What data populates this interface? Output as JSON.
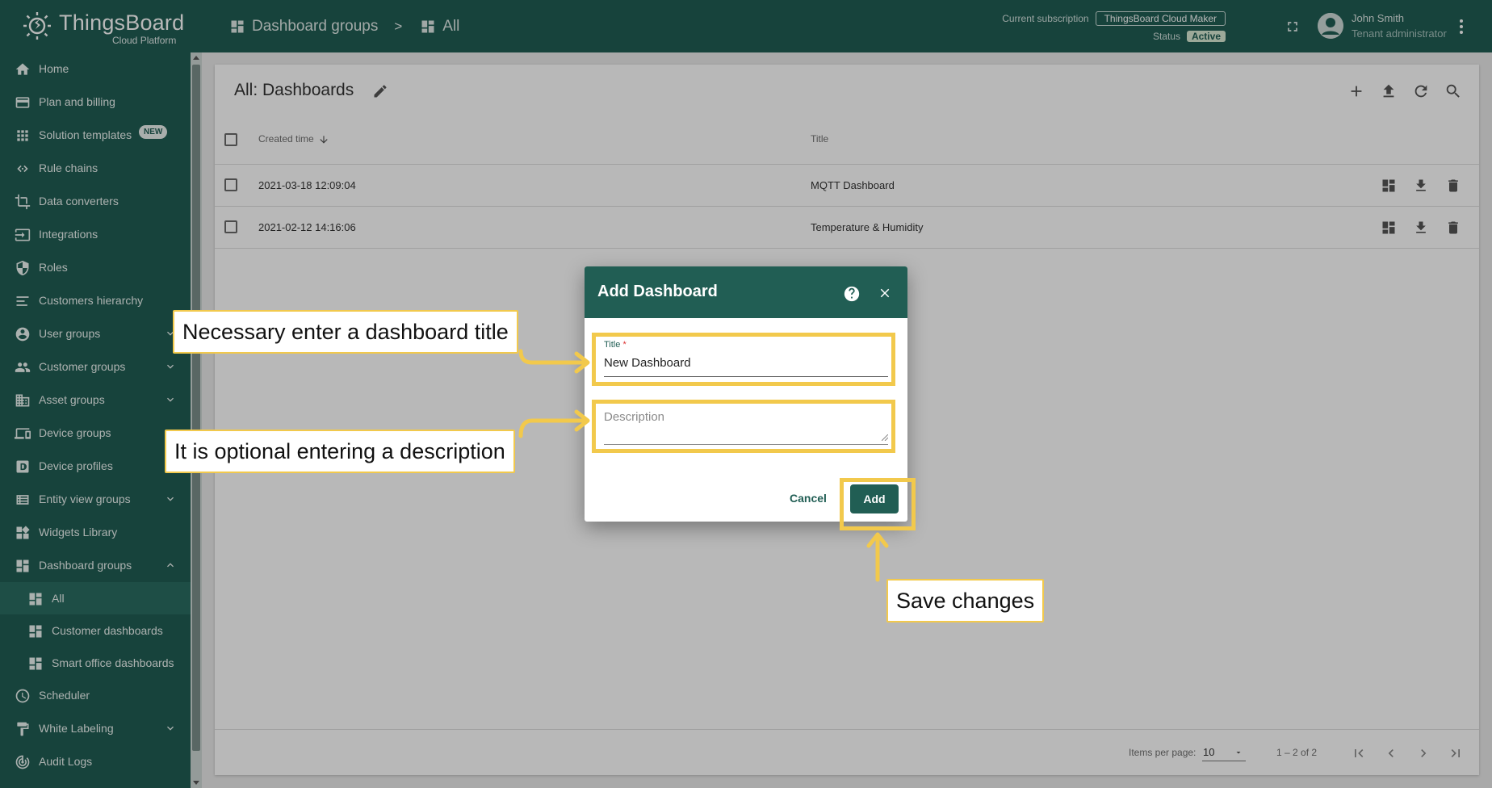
{
  "app": {
    "name": "ThingsBoard",
    "subtitle": "Cloud Platform"
  },
  "breadcrumb": {
    "first": "Dashboard groups",
    "separator": ">",
    "second": "All"
  },
  "subscription": {
    "label": "Current subscription",
    "plan": "ThingsBoard Cloud Maker",
    "status_label": "Status",
    "status": "Active"
  },
  "user": {
    "name": "John Smith",
    "role": "Tenant administrator"
  },
  "sidebar": {
    "items": [
      {
        "label": "Home",
        "icon": "home-icon"
      },
      {
        "label": "Plan and billing",
        "icon": "credit-card-icon"
      },
      {
        "label": "Solution templates",
        "icon": "apps-grid-icon",
        "badge": "NEW"
      },
      {
        "label": "Rule chains",
        "icon": "rule-chain-icon"
      },
      {
        "label": "Data converters",
        "icon": "converter-icon"
      },
      {
        "label": "Integrations",
        "icon": "integration-icon"
      },
      {
        "label": "Roles",
        "icon": "shield-icon"
      },
      {
        "label": "Customers hierarchy",
        "icon": "hierarchy-icon"
      },
      {
        "label": "User groups",
        "icon": "account-circle-icon"
      },
      {
        "label": "Customer groups",
        "icon": "people-icon"
      },
      {
        "label": "Asset groups",
        "icon": "domain-icon"
      },
      {
        "label": "Device groups",
        "icon": "devices-icon"
      },
      {
        "label": "Device profiles",
        "icon": "device-profile-icon"
      },
      {
        "label": "Entity view groups",
        "icon": "view-list-icon"
      },
      {
        "label": "Widgets Library",
        "icon": "widgets-icon"
      },
      {
        "label": "Dashboard groups",
        "icon": "dashboard-icon"
      },
      {
        "label": "All",
        "icon": "dashboard-icon"
      },
      {
        "label": "Customer dashboards",
        "icon": "dashboard-icon"
      },
      {
        "label": "Smart office dashboards",
        "icon": "dashboard-icon"
      },
      {
        "label": "Scheduler",
        "icon": "clock-icon"
      },
      {
        "label": "White Labeling",
        "icon": "format-paint-icon"
      },
      {
        "label": "Audit Logs",
        "icon": "track-changes-icon"
      }
    ]
  },
  "main": {
    "title": "All: Dashboards",
    "columns": {
      "created": "Created time",
      "title": "Title"
    },
    "rows": [
      {
        "created": "2021-03-18 12:09:04",
        "title": "MQTT Dashboard"
      },
      {
        "created": "2021-02-12 14:16:06",
        "title": "Temperature & Humidity"
      }
    ],
    "paginator": {
      "items_label": "Items per page:",
      "page_size": "10",
      "range": "1 – 2 of 2"
    }
  },
  "dialog": {
    "title": "Add Dashboard",
    "title_field_label": "Title",
    "title_field_required": "*",
    "title_field_value": "New Dashboard",
    "description_placeholder": "Description",
    "cancel_label": "Cancel",
    "add_label": "Add"
  },
  "annotations": {
    "title_note": "Necessary enter a dashboard title",
    "description_note": "It is optional entering a description",
    "save_note": "Save changes",
    "highlight_color": "#f2c94c"
  },
  "colors": {
    "brand": "#215e54"
  }
}
